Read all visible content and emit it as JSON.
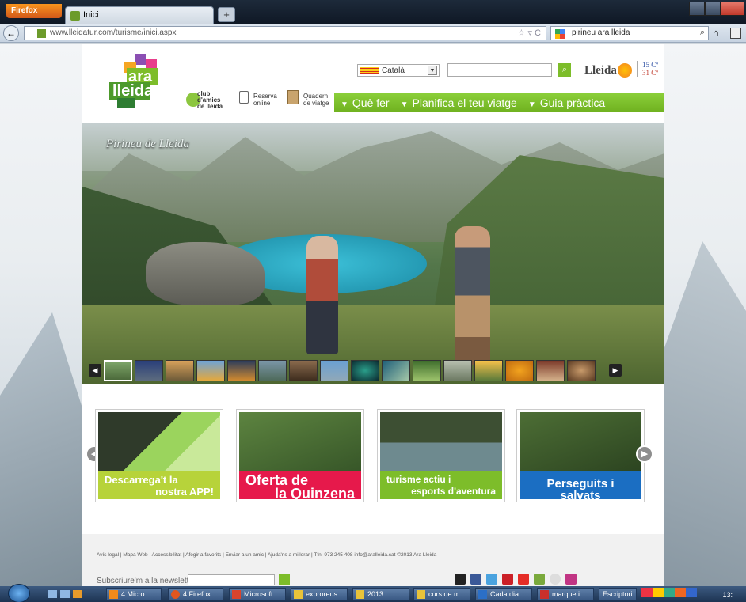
{
  "browser": {
    "menu_button": "Firefox",
    "tab_title": "Inici",
    "new_tab": "+",
    "url": "www.lleidatur.com/turisme/inici.aspx",
    "search_value": "pirineu ara lleida"
  },
  "site": {
    "logo_line1": "ara",
    "logo_line2": "lleida",
    "language": "Català",
    "city": "Lleida",
    "temp_min": "15 Cº",
    "temp_max": "31 Cº",
    "club_label": "club d'amics de lleida",
    "reserva_line1": "Reserva",
    "reserva_line2": "online",
    "quadern_line1": "Quadern",
    "quadern_line2": "de viatge",
    "menu": [
      "Què fer",
      "Planifica el teu viatge",
      "Guia pràctica"
    ],
    "hero_caption": "Pirineu de Lleida",
    "promos": [
      {
        "line1": "Descarrega't la",
        "line2": "nostra APP!"
      },
      {
        "line1": "Oferta de",
        "line2": "la Quinzena"
      },
      {
        "line1": "turisme actiu i",
        "line2": "esports d'aventura"
      },
      {
        "line1": "Perseguits i salvats",
        "line2": ""
      }
    ],
    "footer_links": "Avís legal | Mapa Web | Accessibilitat | Afegir a favorits | Enviar a un amic | Ajuda'ns a millorar | Tfn. 973 245 408 info@aralleida.cat ©2013 Ara Lleida",
    "newsletter_label": "Subscriure'm a la newsletter"
  },
  "taskbar": {
    "items": [
      "4 Micro...",
      "4 Firefox",
      "Microsoft...",
      "exproreus...",
      "2013",
      "curs de m...",
      "Cada dia ...",
      "marqueti...",
      "Escriptori"
    ],
    "clock": "13:"
  },
  "colors": {
    "brand_green": "#7dbd2a",
    "app_yellow": "#b7d33a",
    "offer_red": "#e6194b",
    "persegs_blue": "#1b6ec2"
  }
}
